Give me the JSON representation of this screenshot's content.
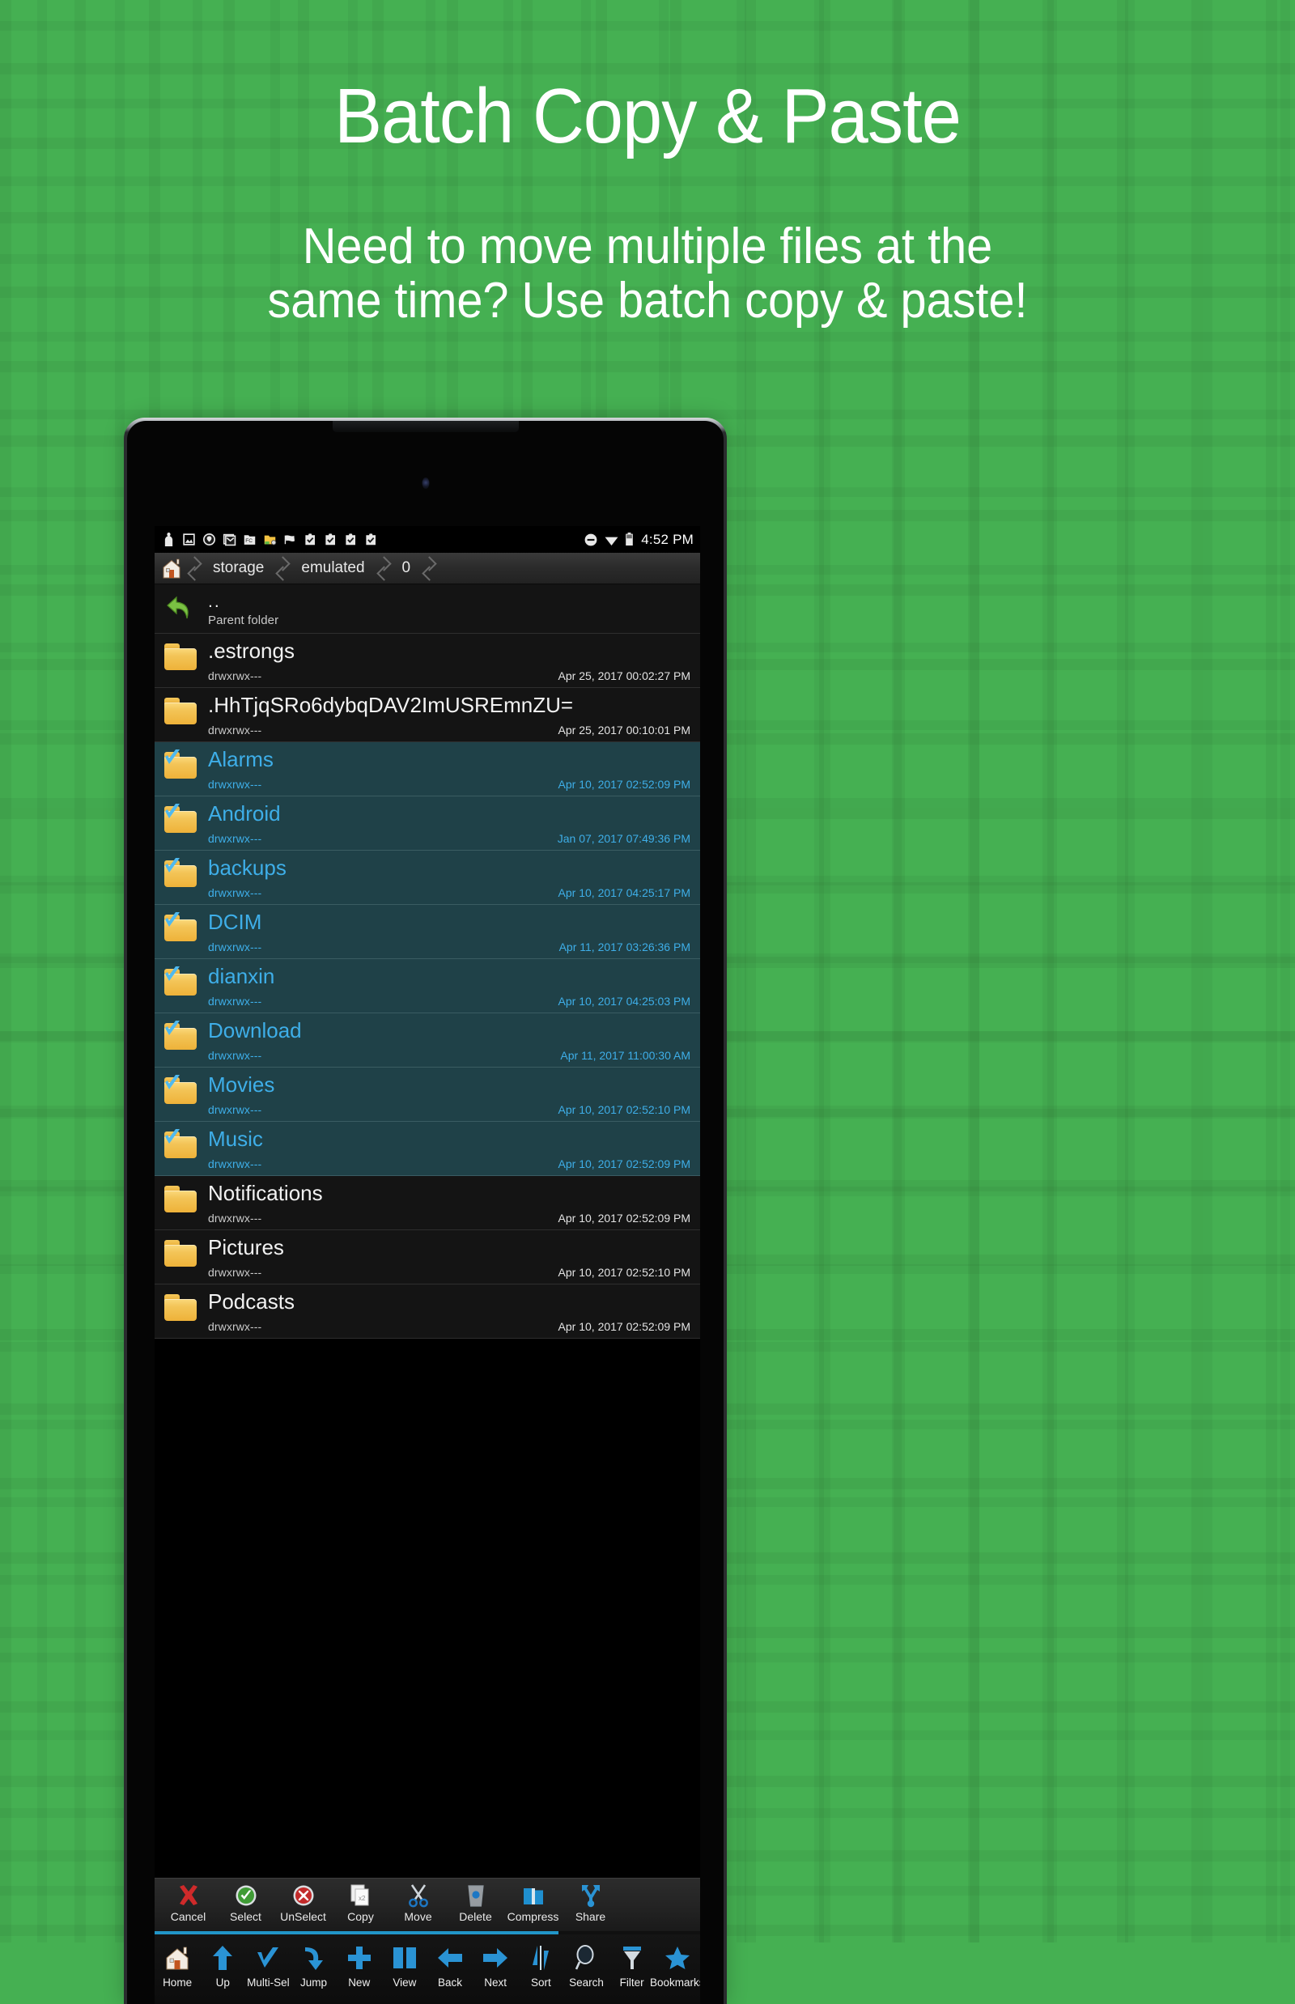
{
  "theme": {
    "background_green": "#45b052",
    "accent_blue": "#3eaee8",
    "selected_row_bg": "#1f4148",
    "row_bg": "#141414",
    "progress_blue": "#2196c9"
  },
  "promo": {
    "title": "Batch Copy & Paste",
    "subtitle_line1": "Need to move multiple files at the",
    "subtitle_line2": "same time? Use batch copy & paste!"
  },
  "status_bar": {
    "left_icons": [
      "person-icon",
      "image-icon",
      "shield-icon",
      "gmail-icon",
      "fc-folder-icon",
      "yellow-folder-icon",
      "cloud-flag-icon",
      "clipboard-check-icon",
      "clipboard-check-icon",
      "clipboard-check-icon",
      "clipboard-check-icon"
    ],
    "right_icons": [
      "do-not-disturb-icon",
      "wifi-icon",
      "battery-icon"
    ],
    "time": "4:52 PM"
  },
  "breadcrumb": {
    "home_icon": "home-icon",
    "crumbs": [
      "storage",
      "emulated",
      "0"
    ]
  },
  "parent_row": {
    "name": "..",
    "label": "Parent folder",
    "icon": "back-arrow-icon"
  },
  "file_list": [
    {
      "name": ".estrongs",
      "perm": "drwxrwx---",
      "date": "Apr 25, 2017 00:02:27 PM",
      "selected": false
    },
    {
      "name": ".HhTjqSRo6dybqDAV2ImUSREmnZU=",
      "perm": "drwxrwx---",
      "date": "Apr 25, 2017 00:10:01 PM",
      "selected": false
    },
    {
      "name": "Alarms",
      "perm": "drwxrwx---",
      "date": "Apr 10, 2017 02:52:09 PM",
      "selected": true
    },
    {
      "name": "Android",
      "perm": "drwxrwx---",
      "date": "Jan 07, 2017 07:49:36 PM",
      "selected": true
    },
    {
      "name": "backups",
      "perm": "drwxrwx---",
      "date": "Apr 10, 2017 04:25:17 PM",
      "selected": true
    },
    {
      "name": "DCIM",
      "perm": "drwxrwx---",
      "date": "Apr 11, 2017 03:26:36 PM",
      "selected": true
    },
    {
      "name": "dianxin",
      "perm": "drwxrwx---",
      "date": "Apr 10, 2017 04:25:03 PM",
      "selected": true
    },
    {
      "name": "Download",
      "perm": "drwxrwx---",
      "date": "Apr 11, 2017 11:00:30 AM",
      "selected": true
    },
    {
      "name": "Movies",
      "perm": "drwxrwx---",
      "date": "Apr 10, 2017 02:52:10 PM",
      "selected": true
    },
    {
      "name": "Music",
      "perm": "drwxrwx---",
      "date": "Apr 10, 2017 02:52:09 PM",
      "selected": true
    },
    {
      "name": "Notifications",
      "perm": "drwxrwx---",
      "date": "Apr 10, 2017 02:52:09 PM",
      "selected": false
    },
    {
      "name": "Pictures",
      "perm": "drwxrwx---",
      "date": "Apr 10, 2017 02:52:10 PM",
      "selected": false
    },
    {
      "name": "Podcasts",
      "perm": "drwxrwx---",
      "date": "Apr 10, 2017 02:52:09 PM",
      "selected": false
    }
  ],
  "action_toolbar": [
    {
      "label": "Cancel",
      "icon": "red-x-icon"
    },
    {
      "label": "Select",
      "icon": "green-check-circle-icon"
    },
    {
      "label": "UnSelect",
      "icon": "red-x-circle-icon"
    },
    {
      "label": "Copy",
      "icon": "copy-pages-icon"
    },
    {
      "label": "Move",
      "icon": "scissors-icon"
    },
    {
      "label": "Delete",
      "icon": "trash-glass-icon"
    },
    {
      "label": "Compress",
      "icon": "zip-folder-icon"
    },
    {
      "label": "Share",
      "icon": "share-nodes-icon"
    }
  ],
  "nav_bar": [
    {
      "label": "Home",
      "icon": "home-icon"
    },
    {
      "label": "Up",
      "icon": "arrow-up-icon"
    },
    {
      "label": "Multi-Sel",
      "icon": "checkmark-icon"
    },
    {
      "label": "Jump",
      "icon": "curved-arrow-icon"
    },
    {
      "label": "New",
      "icon": "plus-icon"
    },
    {
      "label": "View",
      "icon": "columns-icon"
    },
    {
      "label": "Back",
      "icon": "arrow-left-icon"
    },
    {
      "label": "Next",
      "icon": "arrow-right-icon"
    },
    {
      "label": "Sort",
      "icon": "sort-icon"
    },
    {
      "label": "Search",
      "icon": "magnifier-icon"
    },
    {
      "label": "Filter",
      "icon": "funnel-icon"
    },
    {
      "label": "Bookmarks",
      "icon": "star-icon"
    }
  ],
  "progress": {
    "percent": 74
  }
}
